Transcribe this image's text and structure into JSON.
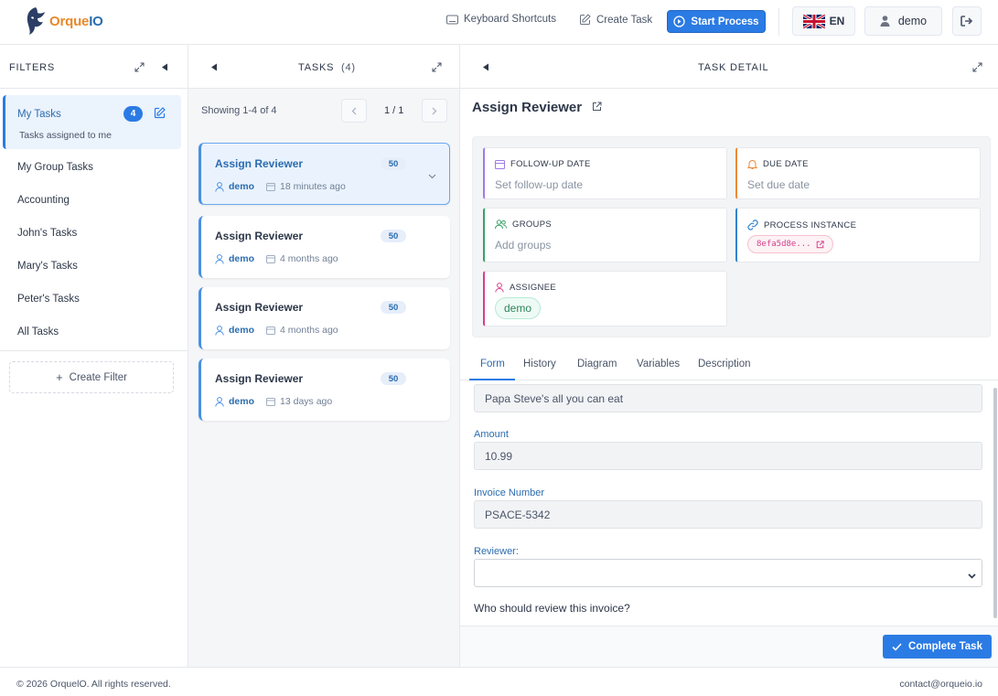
{
  "header": {
    "logo_text_a": "Orque",
    "logo_text_b": "IO",
    "keyboard_shortcuts": "Keyboard Shortcuts",
    "create_task": "Create Task",
    "start_process": "Start Process",
    "language": "EN",
    "user": "demo"
  },
  "filters": {
    "title": "FILTERS",
    "active": {
      "label": "My Tasks",
      "count": "4",
      "subtitle": "Tasks assigned to me"
    },
    "items": [
      "My Group Tasks",
      "Accounting",
      "John's Tasks",
      "Mary's Tasks",
      "Peter's Tasks",
      "All Tasks"
    ],
    "create_filter": "Create Filter"
  },
  "tasks": {
    "title": "TASKS",
    "count": "(4)",
    "showing": "Showing 1-4 of 4",
    "page": "1 / 1",
    "list": [
      {
        "title": "Assign Reviewer",
        "priority": "50",
        "assignee": "demo",
        "time": "18 minutes ago"
      },
      {
        "title": "Assign Reviewer",
        "priority": "50",
        "assignee": "demo",
        "time": "4 months ago"
      },
      {
        "title": "Assign Reviewer",
        "priority": "50",
        "assignee": "demo",
        "time": "4 months ago"
      },
      {
        "title": "Assign Reviewer",
        "priority": "50",
        "assignee": "demo",
        "time": "13 days ago"
      }
    ]
  },
  "detail": {
    "header_title": "TASK DETAIL",
    "task_title": "Assign Reviewer",
    "followup": {
      "label": "FOLLOW-UP DATE",
      "value": "Set follow-up date",
      "color": "#9f7aea"
    },
    "due": {
      "label": "DUE DATE",
      "value": "Set due date",
      "color": "#ed8936"
    },
    "groups": {
      "label": "GROUPS",
      "value": "Add groups",
      "color": "#38a169"
    },
    "process_instance": {
      "label": "PROCESS INSTANCE",
      "value": "8efa5d8e...",
      "color": "#3182ce"
    },
    "assignee": {
      "label": "ASSIGNEE",
      "value": "demo",
      "color": "#d53f8c"
    },
    "tabs": [
      "Form",
      "History",
      "Diagram",
      "Variables",
      "Description"
    ],
    "form": {
      "creditor_value": "Papa Steve's all you can eat",
      "amount_label": "Amount",
      "amount_value": "10.99",
      "invoice_label": "Invoice Number",
      "invoice_value": "PSACE-5342",
      "reviewer_label": "Reviewer:",
      "reviewer_value": "",
      "help": "Who should review this invoice?"
    },
    "complete_button": "Complete Task"
  },
  "footer": {
    "copyright": "© 2026 OrquelO. All rights reserved.",
    "contact": "contact@orqueio.io"
  }
}
